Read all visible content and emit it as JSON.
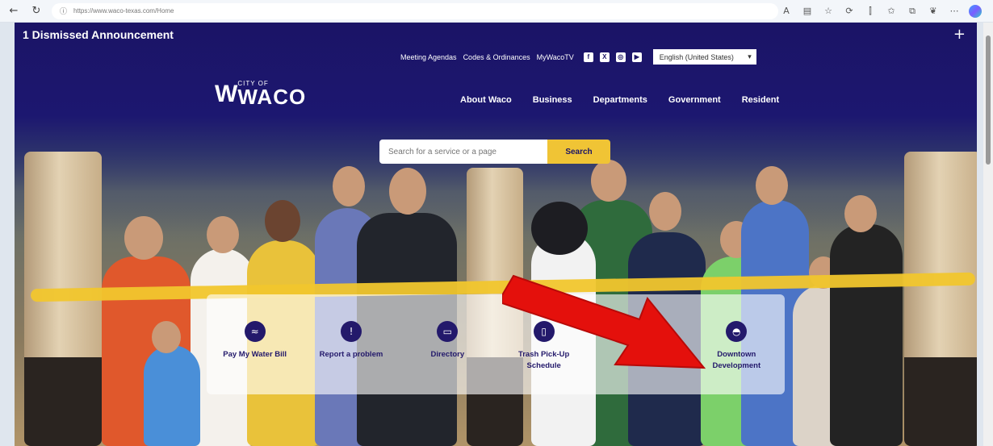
{
  "browser": {
    "back_icon": "back-arrow-icon",
    "refresh_icon": "refresh-icon",
    "url": "https://www.waco-texas.com/Home",
    "toolbar_icons": [
      "read-aloud-icon",
      "reader-view-icon",
      "favorite-star-icon",
      "extensions-icon",
      "split-screen-icon",
      "favorites-icon",
      "collections-icon",
      "shield-icon",
      "more-icon",
      "copilot-icon"
    ]
  },
  "announcement": {
    "text": "1 Dismissed Announcement",
    "toggle": "+"
  },
  "utility_nav": {
    "links": [
      "Meeting Agendas",
      "Codes & Ordinances",
      "MyWacoTV"
    ],
    "social": [
      {
        "icon": "facebook-icon",
        "glyph": "f"
      },
      {
        "icon": "x-twitter-icon",
        "glyph": "X"
      },
      {
        "icon": "instagram-icon",
        "glyph": "◎"
      },
      {
        "icon": "youtube-icon",
        "glyph": "▶"
      }
    ],
    "language": "English (United States)"
  },
  "logo": {
    "city_of": "CITY OF",
    "name": "WACO"
  },
  "main_nav": [
    "About Waco",
    "Business",
    "Departments",
    "Government",
    "Resident"
  ],
  "search": {
    "placeholder": "Search for a service or a page",
    "button": "Search"
  },
  "quick_links": [
    {
      "label": "Pay My Water Bill",
      "icon": "water-drop-icon",
      "glyph": "💧"
    },
    {
      "label": "Report a problem",
      "icon": "speech-bubble-icon",
      "glyph": "!"
    },
    {
      "label": "Directory",
      "icon": "folder-icon",
      "glyph": "▭"
    },
    {
      "label": "Trash Pick-Up Schedule",
      "icon": "trash-bin-icon",
      "glyph": "▯"
    },
    {
      "label": "",
      "icon": "",
      "glyph": ""
    },
    {
      "label": "Downtown Development",
      "icon": "city-dome-icon",
      "glyph": "◓"
    }
  ],
  "colors": {
    "brand_navy": "#1b1466",
    "accent_yellow": "#f0c435",
    "annotation_red": "#e4100c"
  }
}
